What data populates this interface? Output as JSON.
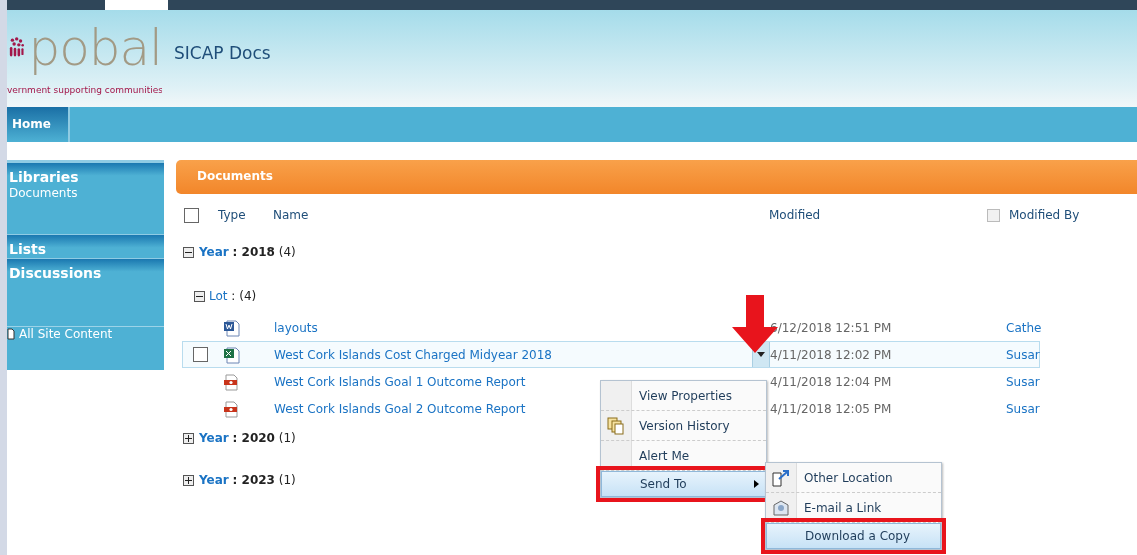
{
  "header": {
    "logo_text": "pobal",
    "tagline": "vernment supporting communities",
    "site_title": "SICAP Docs"
  },
  "nav": [
    {
      "label": "Home",
      "selected": true
    }
  ],
  "sidebar": {
    "sections": [
      {
        "title": "Libraries",
        "items": [
          "Documents"
        ]
      },
      {
        "title": "Lists"
      },
      {
        "title": "Discussions"
      }
    ],
    "all_content": "All Site Content"
  },
  "panel_title": "Documents",
  "select_all_checked": false,
  "modified_by_checked": false,
  "columns": [
    "Type",
    "Name",
    "Modified",
    "Modified By"
  ],
  "groups": [
    {
      "label": "Year",
      "value": ": 2018",
      "count": "(4)",
      "expanded": true,
      "subgroups": [
        {
          "label": "Lot",
          "count": ":  (4)",
          "expanded": true,
          "rows": [
            {
              "kind": "word",
              "name": "layouts",
              "modified": "6/12/2018 12:51 PM",
              "modified_by": "Cathe",
              "selected": false
            },
            {
              "kind": "excel",
              "name": "West Cork Islands Cost Charged Midyear 2018",
              "modified": "4/11/2018 12:02 PM",
              "modified_by": "Susar",
              "selected": true
            },
            {
              "kind": "pdf",
              "name": "West Cork Islands Goal 1 Outcome Report",
              "modified": "4/11/2018 12:04 PM",
              "modified_by": "Susar",
              "selected": false
            },
            {
              "kind": "pdf",
              "name": "West Cork Islands Goal 2 Outcome Report",
              "modified": "4/11/2018 12:05 PM",
              "modified_by": "Susar",
              "selected": false
            }
          ]
        }
      ]
    },
    {
      "label": "Year",
      "value": ": 2020",
      "count": "(1)",
      "expanded": false
    },
    {
      "label": "Year",
      "value": ": 2023",
      "count": "(1)",
      "expanded": false
    }
  ],
  "context_menu": [
    {
      "label": "View Properties",
      "highlighted": false,
      "submenu": false
    },
    {
      "label": "Version History",
      "highlighted": false,
      "submenu": false
    },
    {
      "label": "Alert Me",
      "highlighted": false,
      "submenu": false
    },
    {
      "label": "Send To",
      "highlighted": true,
      "submenu": true
    }
  ],
  "submenu": [
    {
      "label": "Other Location",
      "highlighted": false
    },
    {
      "label": "E-mail a Link",
      "highlighted": false
    },
    {
      "label": "Download a Copy",
      "highlighted": true
    }
  ]
}
